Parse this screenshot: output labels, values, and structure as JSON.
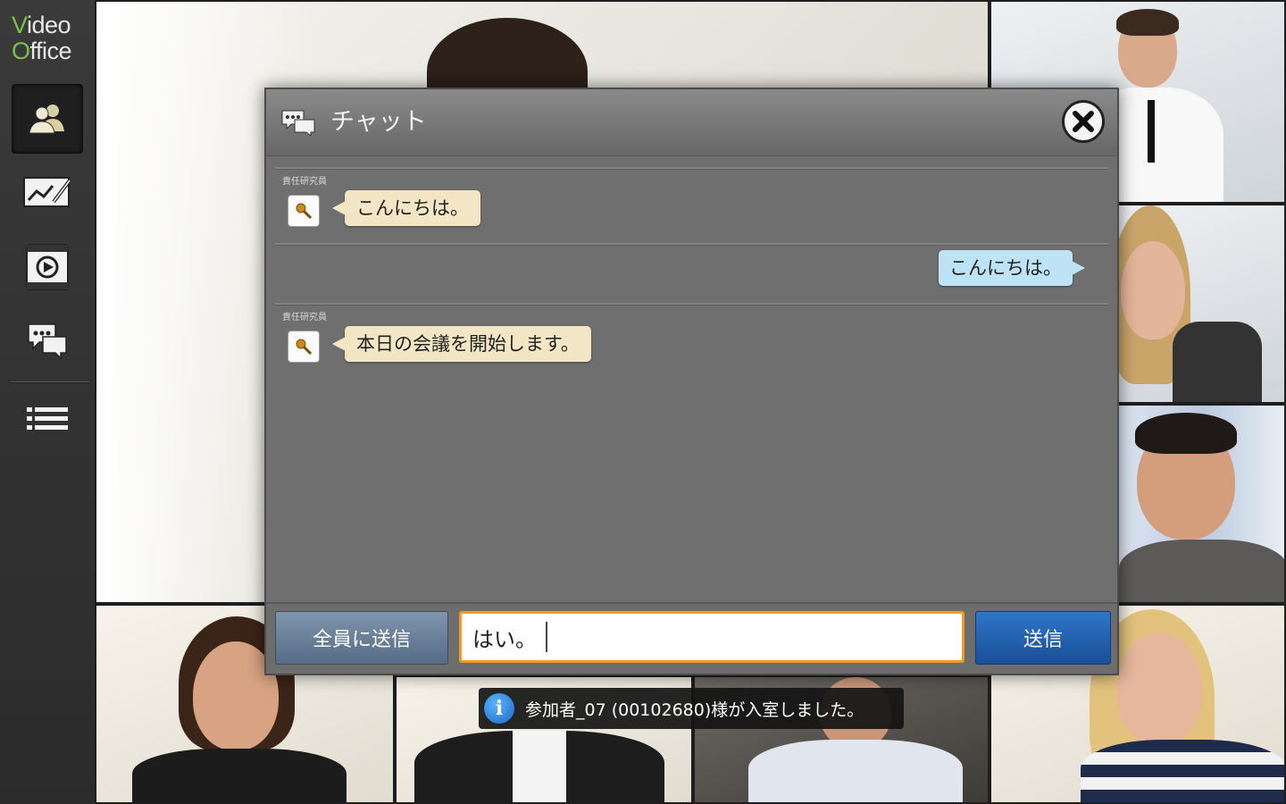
{
  "app": {
    "logo_line1": "Video",
    "logo_line2": "Office"
  },
  "sidebar": {
    "items": [
      {
        "icon": "participants-icon",
        "active": true
      },
      {
        "icon": "whiteboard-icon",
        "active": false
      },
      {
        "icon": "video-file-icon",
        "active": false
      },
      {
        "icon": "chat-icon",
        "active": false
      },
      {
        "icon": "menu-list-icon",
        "active": false
      }
    ]
  },
  "chat": {
    "title": "チャット",
    "messages": [
      {
        "direction": "in",
        "sender": "責任研究員",
        "text": "こんにちは。"
      },
      {
        "direction": "out",
        "sender": "",
        "text": "こんにちは。"
      },
      {
        "direction": "in",
        "sender": "責任研究員",
        "text": "本日の会議を開始します。"
      }
    ],
    "send_all_label": "全員に送信",
    "input_value": "はい。",
    "send_label": "送信"
  },
  "toast": {
    "text": "参加者_07 (00102680)様が入室しました。"
  },
  "colors": {
    "incoming_bubble": "#f3e6c4",
    "outgoing_bubble": "#bfe3f6",
    "send_button": "#1f5fab",
    "input_border": "#f39a21",
    "logo_accent": "#7cc04b"
  }
}
